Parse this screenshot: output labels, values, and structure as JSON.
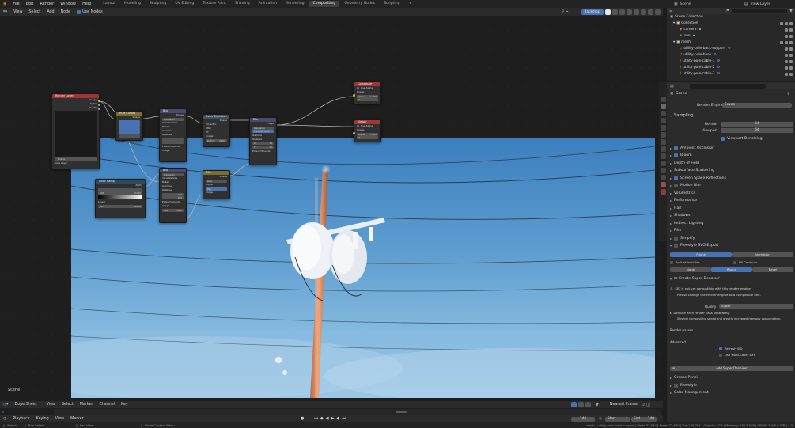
{
  "topbar": {
    "menus": [
      "File",
      "Edit",
      "Render",
      "Window",
      "Help"
    ],
    "workspaces": [
      "Layout",
      "Modeling",
      "Sculpting",
      "UV Editing",
      "Texture Paint",
      "Shading",
      "Animation",
      "Rendering",
      "Compositing",
      "Geometry Nodes",
      "Scripting"
    ],
    "active_workspace": "Compositing",
    "add_tab": "+",
    "scene_name": "Scene",
    "view_layer": "View Layer"
  },
  "node_editor": {
    "menus": [
      "View",
      "Select",
      "Add",
      "Node"
    ],
    "use_nodes": "Use Nodes",
    "backdrop": "Backdrop",
    "scene_label": "Scene",
    "nodes": {
      "render_layers": {
        "title": "Render Layers",
        "outputs": [
          "Image",
          "Alpha",
          "Depth"
        ],
        "scene": "Scene",
        "layer": "View Layer"
      },
      "rgb_curves": {
        "title": "RGB Curves",
        "out": "Image"
      },
      "blur1": {
        "title": "Blur",
        "out": "Image",
        "rows": [
          "Gaussian",
          "Variable Size",
          "Bokeh",
          "Gamma",
          "Relative"
        ],
        "size_x": "X",
        "size_y": "Y",
        "extend": "Extend Bounds",
        "image": "Image",
        "size": "Size"
      },
      "lens_distortion": {
        "title": "Lens Distortion",
        "out": "Image",
        "rows": [
          "Projector",
          "Jitter",
          "Fit",
          "Image",
          "Distort",
          "Dispersion"
        ],
        "distort": "0.000",
        "disp": "0.000"
      },
      "blur2": {
        "title": "Blur",
        "out": "Image",
        "rows": [
          "Gaussian",
          "Variable Size",
          "Gamma",
          "Relative"
        ],
        "x": "X",
        "y": "Y",
        "x_val": "10",
        "y_val": "10",
        "extend": "Extend Bounds",
        "image": "Image",
        "size": "Size"
      },
      "composite": {
        "title": "Composite",
        "use_alpha": "Use Alpha",
        "image": "Image",
        "alpha": "Alpha",
        "alpha_val": "1.000",
        "z": "Z"
      },
      "viewer": {
        "title": "Viewer",
        "use_alpha": "Use Alpha",
        "image": "Image",
        "alpha": "Alpha",
        "alpha_val": "1.000",
        "z": "Z"
      },
      "color_ramp": {
        "title": "Color Ramp",
        "out": "Alpha",
        "pos": "0.000",
        "color": "RGB",
        "interp": "Linear",
        "fac": "Fac",
        "val": "0.000"
      },
      "blur3": {
        "title": "Blur",
        "rows": [
          "Gaussian",
          "Variable Size",
          "Bokeh",
          "Gamma",
          "Relative"
        ],
        "x_val": "100",
        "y_val": "100",
        "extend": "Extend Bounds",
        "image": "Image",
        "size": "Size",
        "size_val": "1.000"
      },
      "mix": {
        "title": "Mix",
        "out": "Image",
        "rows": [
          "Add",
          "Alpha",
          "Clamp",
          "Fac",
          "Image",
          "Image"
        ],
        "fac": "Fac"
      }
    }
  },
  "outliner": {
    "rows": [
      {
        "label": "Scene Collection",
        "indent": 0
      },
      {
        "label": "Collection",
        "indent": 1
      },
      {
        "label": "camera",
        "indent": 2
      },
      {
        "label": "sun",
        "indent": 2
      },
      {
        "label": "mesh",
        "indent": 1
      },
      {
        "label": "utility-pole-back-support",
        "indent": 2
      },
      {
        "label": "utility-pole-base",
        "indent": 2
      },
      {
        "label": "utility-pole-cable-1",
        "indent": 2
      },
      {
        "label": "utility-pole-cable-2",
        "indent": 2
      },
      {
        "label": "utility-pole-cable-3",
        "indent": 2
      }
    ]
  },
  "properties": {
    "scene": "Scene",
    "render_engine_label": "Render Engine",
    "render_engine": "Eevee",
    "sampling": "Sampling",
    "render_label": "Render",
    "render_val": "64",
    "viewport_label": "Viewport",
    "viewport_val": "64",
    "viewport_denoising": "Viewport Denoising",
    "panels": [
      "Ambient Occlusion",
      "Bloom",
      "Depth of Field",
      "Subsurface Scattering",
      "Screen Space Reflections",
      "Motion Blur",
      "Volumetrics",
      "Performance",
      "Hair",
      "Shadows",
      "Indirect Lighting",
      "Film",
      "Simplify",
      "Freestyle SVG Export"
    ],
    "panel_checked": [
      true,
      true,
      false,
      false,
      true,
      false,
      false,
      false,
      false,
      false,
      false,
      false,
      false,
      false
    ],
    "frame_tab": "Frame",
    "animation_tab": "Animation",
    "split_invisible": "Split at Invisible",
    "fill_contours": "Fill Contours",
    "none": "None",
    "round": "Round",
    "bevel": "Bevel",
    "super_denoiser": "Create Super Denoiser",
    "warning1": "SID is not yet compatible with this render engine.",
    "warning2": "Please change the render engine to a compatible one.",
    "quality_label": "Quality",
    "quality_val": "Super",
    "denoise_pass": "Denoise each render pass separately.",
    "slowest": "Slowest compositing speed and greatly increased memory consumption.",
    "render_passes": "Render passes",
    "advanced": "Advanced",
    "refresh_sid": "Refresh SID",
    "multilayer": "Use Multi-Layer EXR",
    "add_super_denoiser": "Add Super Denoiser",
    "grease_pencil": "Grease Pencil",
    "freestyle": "Freestyle",
    "color_management": "Color Management"
  },
  "timeline": {
    "editor": "Dope Sheet",
    "menus": [
      "View",
      "Select",
      "Marker",
      "Channel",
      "Key"
    ],
    "nearest_frame": "Nearest Frame",
    "playback": "Playback",
    "keying": "Keying",
    "view": "View",
    "marker": "Marker",
    "current_frame": "144",
    "start_label": "Start",
    "start": "1",
    "end_label": "End",
    "end": "240"
  },
  "statusbar": {
    "select": "Select",
    "box_select": "Box Select",
    "pan_view": "Pan View",
    "context_menu": "Node Context Menu",
    "stats": "mesh | utility-pole-front-support | Verts:73,044 | Faces:72,650 | Tris:145,764 | Objects:1/19 | Memory: 232.8 MiB | VRAM: 3.4/8.0 GiB | 3.0"
  },
  "colors": {
    "accent": "#4772b3",
    "node_input_header": "#a03535",
    "node_filter_header": "#4a4a6e",
    "node_distort_header": "#3d5260",
    "node_color_header": "#7a6d2c",
    "node_converter_header": "#2f4a5e"
  }
}
